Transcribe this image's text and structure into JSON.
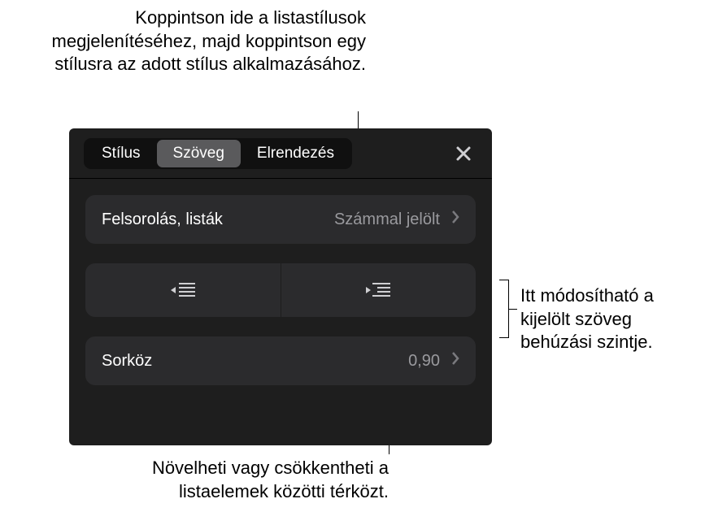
{
  "callouts": {
    "top": "Koppintson ide a listastílusok megjelenítéséhez, majd koppintson egy stílusra az adott stílus alkalmazásához.",
    "right": "Itt módosítható a kijelölt szöveg behúzási szintje.",
    "bottom": "Növelheti vagy csökkentheti a listaelemek közötti térközt."
  },
  "tabs": {
    "style": "Stílus",
    "text": "Szöveg",
    "layout": "Elrendezés"
  },
  "rows": {
    "bullets_label": "Felsorolás, listák",
    "bullets_value": "Számmal jelölt",
    "linespacing_label": "Sorköz",
    "linespacing_value": "0,90"
  }
}
